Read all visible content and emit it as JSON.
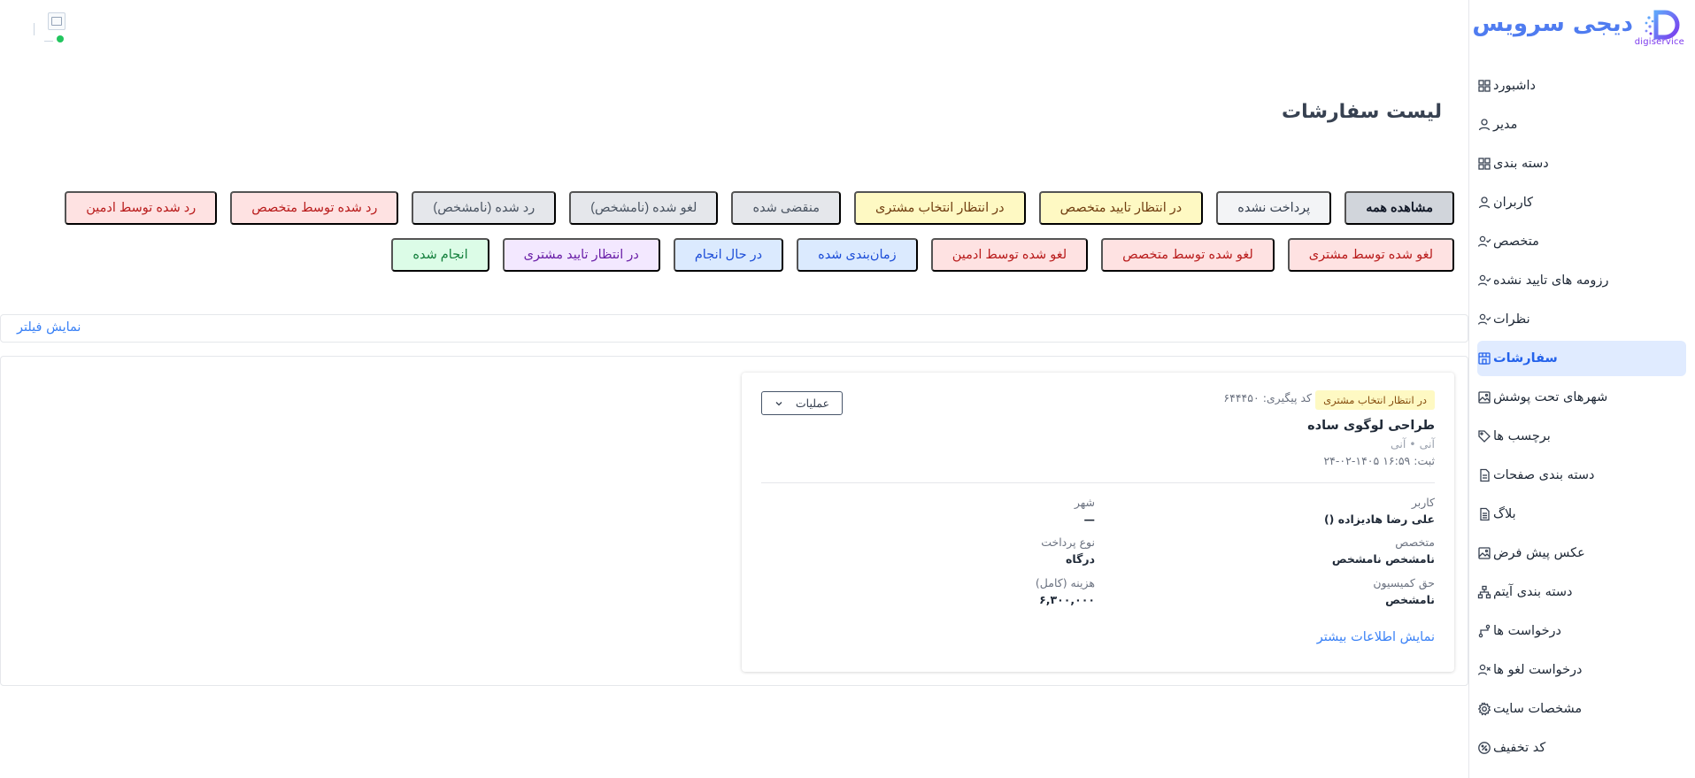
{
  "brand": {
    "title": "دیجی سرویس",
    "subtitle": "digiservice",
    "colors": {
      "primary": "#4f7cf0",
      "accent": "#7c3aed"
    }
  },
  "sidebar": {
    "items": [
      {
        "label": "داشبورد",
        "icon": "dashboard-grid-icon"
      },
      {
        "label": "مدیر",
        "icon": "user-icon"
      },
      {
        "label": "دسته بندی",
        "icon": "category-grid-icon"
      },
      {
        "label": "کاربران",
        "icon": "user-icon"
      },
      {
        "label": "متخصص",
        "icon": "user-check-icon"
      },
      {
        "label": "رزومه های تایید نشده",
        "icon": "user-check-icon"
      },
      {
        "label": "نظرات",
        "icon": "user-check-icon"
      },
      {
        "label": "سفارشات",
        "icon": "store-icon",
        "active": true
      },
      {
        "label": "شهرهای تحت پوشش",
        "icon": "image-icon"
      },
      {
        "label": "برچسب ها",
        "icon": "tag-icon"
      },
      {
        "label": "دسته بندی صفحات",
        "icon": "file-icon"
      },
      {
        "label": "بلاگ",
        "icon": "file-text-icon"
      },
      {
        "label": "عکس پیش فرض",
        "icon": "image-icon"
      },
      {
        "label": "دسته بندی آیتم",
        "icon": "sitemap-icon"
      },
      {
        "label": "درخواست ها",
        "icon": "route-icon"
      },
      {
        "label": "درخواست لغو ها",
        "icon": "user-x-icon"
      },
      {
        "label": "مشخصات سایت",
        "icon": "settings-icon"
      },
      {
        "label": "کد تخفیف",
        "icon": "discount-icon"
      }
    ]
  },
  "page": {
    "title": "لیست سفارشات"
  },
  "filters": {
    "row1": [
      {
        "label": "مشاهده همه",
        "style": "gray-active"
      },
      {
        "label": "پرداخت نشده",
        "style": "light"
      },
      {
        "label": "در انتظار تایید متخصص",
        "style": "yellow"
      },
      {
        "label": "در انتظار انتخاب مشتری",
        "style": "yellow"
      },
      {
        "label": "منقضی شده",
        "style": "gray"
      },
      {
        "label": "لغو شده (نامشخص)",
        "style": "gray"
      },
      {
        "label": "رد شده (نامشخص)",
        "style": "gray"
      },
      {
        "label": "رد شده توسط متخصص",
        "style": "red"
      },
      {
        "label": "رد شده توسط ادمین",
        "style": "red"
      }
    ],
    "row2": [
      {
        "label": "لغو شده توسط مشتری",
        "style": "red"
      },
      {
        "label": "لغو شده توسط متخصص",
        "style": "red"
      },
      {
        "label": "لغو شده توسط ادمین",
        "style": "red"
      },
      {
        "label": "زمان‌بندی شده",
        "style": "blue"
      },
      {
        "label": "در حال انجام",
        "style": "blue"
      },
      {
        "label": "در انتظار تایید مشتری",
        "style": "purple"
      },
      {
        "label": "انجام شده",
        "style": "green"
      }
    ],
    "show_filter_label": "نمایش فیلتر"
  },
  "order": {
    "status": "در انتظار انتخاب مشتری",
    "tracking_label": "کد پیگیری:",
    "tracking_code": "۶۴۴۴۵۰",
    "title": "طراحی لوگوی ساده",
    "subtitle": "آنی • آنی",
    "registered": "ثبت: ۱۶:۵۹ ۱۴۰۵-۰۲-۲۴",
    "operations_label": "عملیات",
    "fields": {
      "user_label": "کاربر",
      "user_value": "علی رضا هادیزاده ()",
      "city_label": "شهر",
      "city_value": "—",
      "specialist_label": "متخصص",
      "specialist_value": "نامشخص نامشخص",
      "payment_label": "نوع پرداخت",
      "payment_value": "درگاه",
      "commission_label": "حق کمیسیون",
      "commission_value": "نامشخص",
      "cost_label": "هزینه (کامل)",
      "cost_value": "۶,۳۰۰,۰۰۰"
    },
    "more_label": "نمایش اطلاعات بیشتر"
  }
}
